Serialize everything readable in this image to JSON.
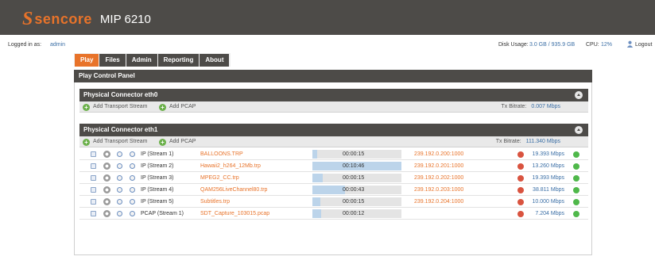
{
  "header": {
    "logo_mark": "S",
    "logo_text": "sencore",
    "product": "MIP 6210"
  },
  "status": {
    "logged_in_label": "Logged in as:",
    "user": "admin",
    "disk_label": "Disk Usage:",
    "disk_value": "3.0 GB / 935.9 GB",
    "cpu_label": "CPU:",
    "cpu_value": "12%",
    "logout": "Logout"
  },
  "tabs": [
    "Play",
    "Files",
    "Admin",
    "Reporting",
    "About"
  ],
  "active_tab": "Play",
  "panel_title": "Play Control Panel",
  "connectors": [
    {
      "title": "Physical Connector eth0",
      "add_ts": "Add Transport Stream",
      "add_pcap": "Add PCAP",
      "tx_label": "Tx Bitrate:",
      "tx_value": "0.007 Mbps",
      "streams": []
    },
    {
      "title": "Physical Connector eth1",
      "add_ts": "Add Transport Stream",
      "add_pcap": "Add PCAP",
      "tx_label": "Tx Bitrate:",
      "tx_value": "111.340 Mbps",
      "streams": [
        {
          "type": "IP (Stream 1)",
          "file": "BALLOONS.TRP",
          "time": "00:00:15",
          "progress": 0.05,
          "dest": "239.192.0.200:1000",
          "rate": "19.393 Mbps"
        },
        {
          "type": "IP (Stream 2)",
          "file": "Hawaii2_h264_12Mb.trp",
          "time": "00:10:46",
          "progress": 1.0,
          "dest": "239.192.0.201:1000",
          "rate": "13.260 Mbps"
        },
        {
          "type": "IP (Stream 3)",
          "file": "MPEG2_CC.trp",
          "time": "00:00:15",
          "progress": 0.12,
          "dest": "239.192.0.202:1000",
          "rate": "19.393 Mbps"
        },
        {
          "type": "IP (Stream 4)",
          "file": "QAM256LiveChannel80.trp",
          "time": "00:00:43",
          "progress": 0.37,
          "dest": "239.192.0.203:1000",
          "rate": "38.811 Mbps"
        },
        {
          "type": "IP (Stream 5)",
          "file": "Subtitles.trp",
          "time": "00:00:15",
          "progress": 0.09,
          "dest": "239.192.0.204:1000",
          "rate": "10.000 Mbps"
        },
        {
          "type": "PCAP (Stream 1)",
          "file": "SDT_Capture_103015.pcap",
          "time": "00:00:12",
          "progress": 0.1,
          "dest": "",
          "rate": "7.204 Mbps"
        }
      ]
    }
  ],
  "colors": {
    "accent": "#e8732a",
    "dark": "#4d4b48",
    "link": "#3a6ea5",
    "progress": "#bcd4ea"
  }
}
